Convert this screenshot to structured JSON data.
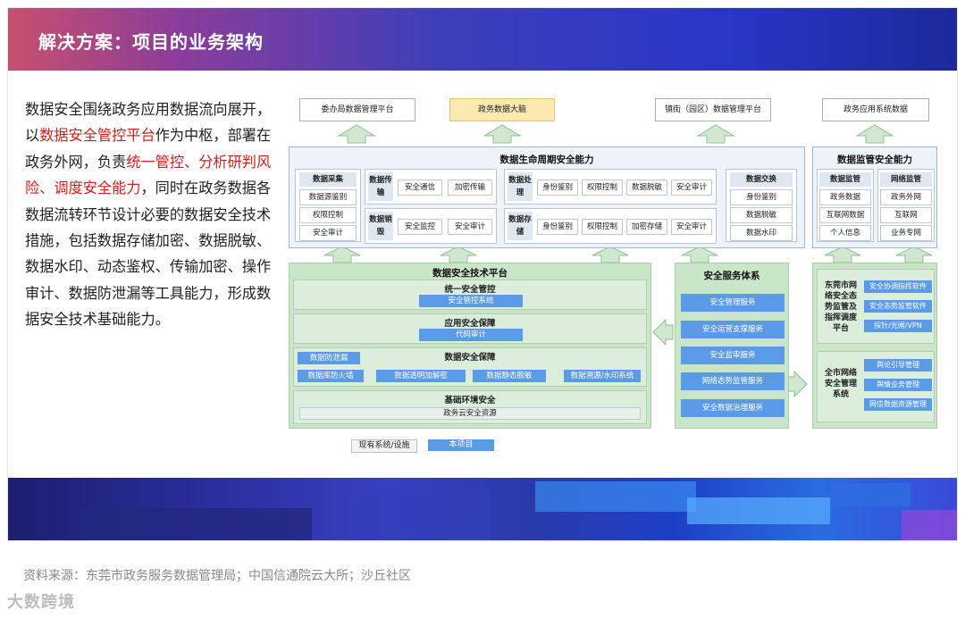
{
  "header": {
    "title": "解决方案：项目的业务架构"
  },
  "description": {
    "segments": [
      {
        "text": "数据安全围绕政务应用数据流向展开，以",
        "red": false
      },
      {
        "text": "数据安全管控平台",
        "red": true
      },
      {
        "text": "作为中枢，部署在政务外网，负责",
        "red": false
      },
      {
        "text": "统一管控、分析研判风险、调度安全能力",
        "red": true
      },
      {
        "text": "，同时在政务数据各数据流转环节设计必要的数据安全技术措施，包括数据存储加密、数据脱敏、数据水印、动态鉴权、传输加密、操作审计、数据防泄漏等工具能力，形成数据安全技术基础能力。",
        "red": false
      }
    ]
  },
  "diagram": {
    "top_boxes": [
      "委办局数据管理平台",
      "政务数据大脑",
      "镇街（园区）数据管理平台",
      "政务应用系统数据"
    ],
    "lifecycle": {
      "title": "数据生命周期安全能力",
      "collect": {
        "header": "数据采集",
        "items": [
          "数据源鉴别",
          "权限控制",
          "安全审计"
        ]
      },
      "transfer": {
        "label": "数据传输",
        "items": [
          "安全通信",
          "加密传输"
        ]
      },
      "destroy": {
        "label": "数据销毁",
        "items": [
          "安全监控",
          "安全审计"
        ]
      },
      "process": {
        "label": "数据处理",
        "items": [
          "身份鉴别",
          "权限控制",
          "数据脱敏",
          "安全审计"
        ]
      },
      "storage": {
        "label": "数据存储",
        "items": [
          "身份鉴别",
          "权限控制",
          "加密存储",
          "安全审计"
        ]
      },
      "exchange": {
        "header": "数据交换",
        "items": [
          "身份鉴别",
          "数据脱敏",
          "数据水印"
        ]
      }
    },
    "monitor": {
      "title": "数据监管安全能力",
      "col1": {
        "header": "数据监管",
        "items": [
          "政务数据",
          "互联网数据",
          "个人信息"
        ]
      },
      "col2": {
        "header": "网络监管",
        "items": [
          "政务外网",
          "互联网",
          "业务专网"
        ]
      }
    },
    "tech_platform": {
      "title": "数据安全技术平台",
      "unified": {
        "title": "统一安全管控",
        "items": [
          "安全管控系统"
        ]
      },
      "app": {
        "title": "应用安全保障",
        "items": [
          "代码审计"
        ]
      },
      "data": {
        "title": "数据安全保障",
        "items": [
          "数据防泄漏",
          "数据库防火墙",
          "数据透明加解密",
          "数据静态脱敏",
          "数据溯源/水印系统"
        ]
      },
      "base": {
        "title": "基础环境安全",
        "items": [
          "政务云安全资源"
        ]
      }
    },
    "service": {
      "title": "安全服务体系",
      "items": [
        "安全管理服务",
        "安全运营支撑服务",
        "安全监审服务",
        "网络态势监管服务",
        "安全数据治理服务"
      ]
    },
    "city": {
      "block1": {
        "label": "东莞市网络安全态势监管及指挥调度平台",
        "items": [
          "安全协调指挥软件",
          "安全态势监管软件",
          "探针/光闸/VPN"
        ]
      },
      "block2": {
        "label": "全市网络安全管理系统",
        "items": [
          "舆论引导管理",
          "舆情业务管理",
          "网信数据资源管理"
        ]
      }
    },
    "legend": {
      "existing": "现有系统/设施",
      "project": "本项目"
    }
  },
  "footer": {
    "source": "资料来源：东莞市政务服务数据管理局；中国信通院云大所；沙丘社区",
    "logo": "大数跨境"
  },
  "colors": {
    "accent_red": "#d0211f",
    "green_panel": "#c9e6c9",
    "blue_item": "#5b9ae6",
    "highlight": "#fbe9b0"
  }
}
